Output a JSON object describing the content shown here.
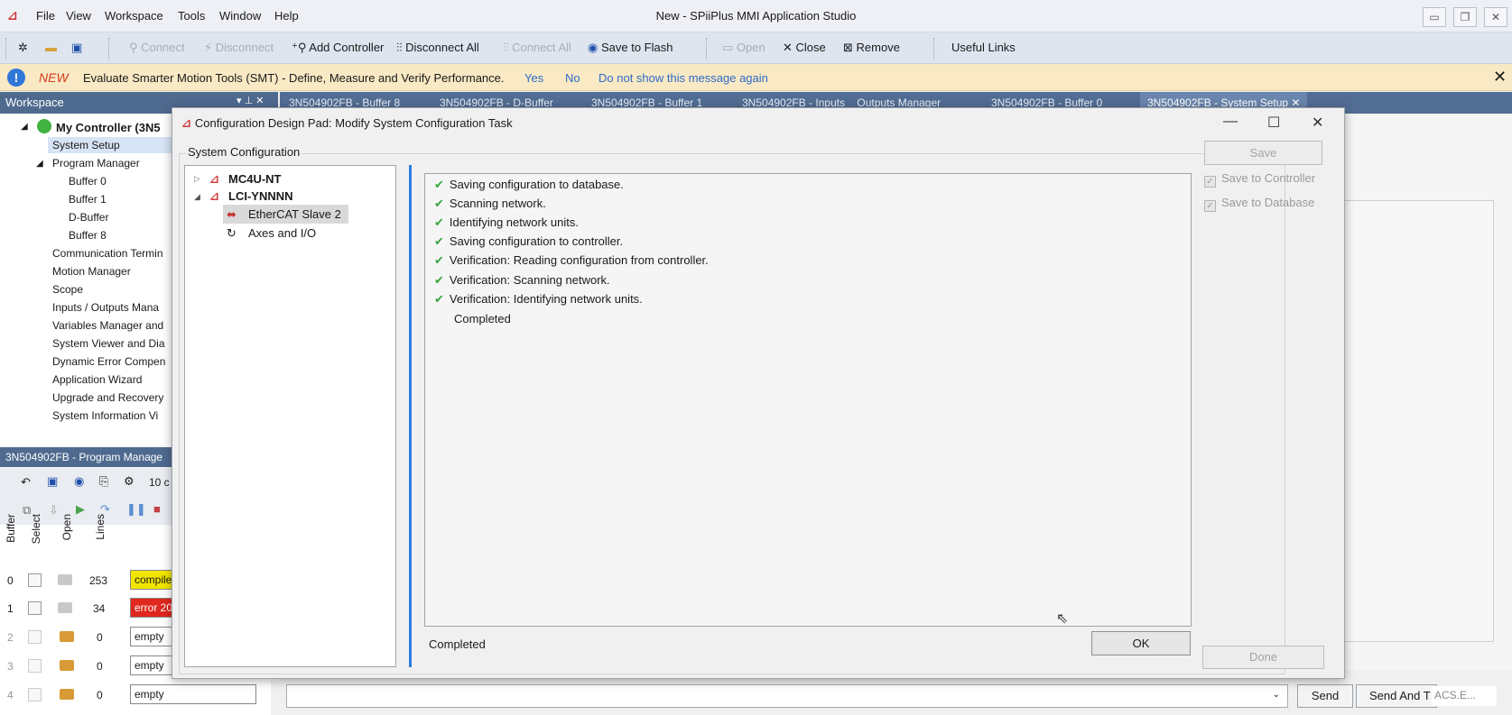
{
  "window": {
    "title": "New - SPiiPlus MMI Application Studio",
    "menu": [
      "File",
      "View",
      "Workspace",
      "Tools",
      "Window",
      "Help"
    ]
  },
  "toolbar": {
    "connect": "Connect",
    "disconnect": "Disconnect",
    "add_controller": "Add Controller",
    "disconnect_all": "Disconnect All",
    "connect_all": "Connect All",
    "save_to_flash": "Save to Flash",
    "open": "Open",
    "close": "Close",
    "remove": "Remove",
    "useful_links": "Useful Links"
  },
  "infobar": {
    "badge": "NEW",
    "message": "Evaluate Smarter Motion Tools (SMT) - Define, Measure and Verify Performance.",
    "yes": "Yes",
    "no": "No",
    "dont_show": "Do not show this message again"
  },
  "workspace": {
    "title": "Workspace",
    "controller": "My Controller (3N5",
    "items": [
      "System Setup",
      "Program Manager",
      "Buffer 0",
      "Buffer 1",
      "D-Buffer",
      "Buffer 8",
      "Communication Termin",
      "Motion Manager",
      "Scope",
      "Inputs / Outputs Mana",
      "Variables Manager and",
      "System Viewer and Dia",
      "Dynamic Error Compen",
      "Application Wizard",
      "Upgrade and Recovery",
      "System Information Vi"
    ]
  },
  "program_manager": {
    "title": "3N504902FB - Program Manage",
    "count_label": "10 c",
    "headers": [
      "Buffer",
      "Select",
      "Open",
      "Lines"
    ],
    "rows": [
      {
        "buffer": "0",
        "lines": "253",
        "state": "compile"
      },
      {
        "buffer": "1",
        "lines": "34",
        "state": "error 20"
      },
      {
        "buffer": "2",
        "lines": "0",
        "state": "empty"
      },
      {
        "buffer": "3",
        "lines": "0",
        "state": "empty"
      },
      {
        "buffer": "4",
        "lines": "0",
        "state": "empty"
      }
    ]
  },
  "tabs": [
    "3N504902FB - Buffer 8",
    "3N504902FB - D-Buffer",
    "3N504902FB - Buffer 1",
    "3N504902FB - Inputs _ Outputs Manager",
    "3N504902FB - Buffer 0",
    "3N504902FB - System Setup"
  ],
  "sendbar": {
    "send": "Send",
    "send_and": "Send And T",
    "acs": "ACS.E..."
  },
  "dialog": {
    "title": "Configuration Design Pad: Modify System Configuration Task",
    "group": "System Configuration",
    "tree": [
      "MC4U-NT",
      "LCI-YNNNN",
      "EtherCAT Slave 2",
      "Axes and I/O"
    ],
    "log": [
      "Saving configuration to database.",
      "Scanning network.",
      "Identifying network units.",
      "Saving configuration to controller.",
      "Verification: Reading configuration from controller.",
      "Verification: Scanning network.",
      "Verification: Identifying network units.",
      "Completed"
    ],
    "status": "Completed",
    "ok": "OK",
    "save": "Save",
    "save_to_controller": "Save to Controller",
    "save_to_database": "Save to Database",
    "done": "Done"
  },
  "colors": {
    "workspace_header": "#4f6a8f",
    "accent_blue": "#2b7de0",
    "check_green": "#39a63f",
    "info_bar": "#f9e9c4",
    "state_compile": "#f2e600",
    "state_error": "#e0281e"
  }
}
